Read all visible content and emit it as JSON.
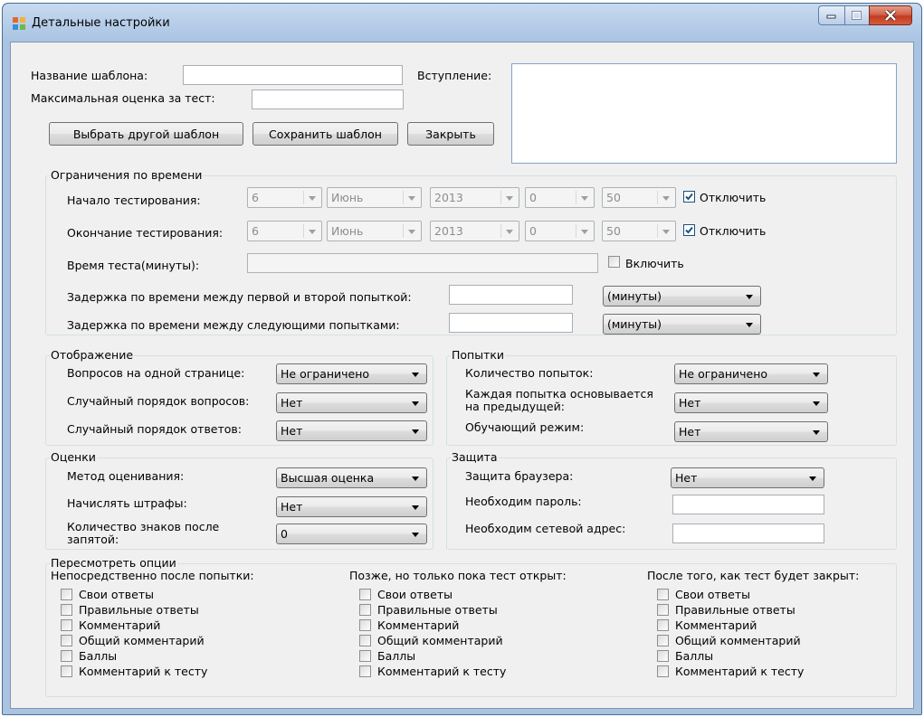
{
  "window": {
    "title": "Детальные настройки"
  },
  "template": {
    "name_label": "Название шаблона:",
    "name_value": "",
    "max_score_label": "Максимальная оценка за тест:",
    "max_score_value": "",
    "intro_label": "Вступление:",
    "intro_value": "",
    "choose_button": "Выбрать другой шаблон",
    "save_button": "Сохранить шаблон",
    "close_button": "Закрыть"
  },
  "time_limits": {
    "title": "Ограничения по времени",
    "start": {
      "label": "Начало тестирования:",
      "day": "6",
      "month": "Июнь",
      "year": "2013",
      "hour": "0",
      "minute": "50",
      "disable_label": "Отключить",
      "disabled": true
    },
    "end": {
      "label": "Окончание тестирования:",
      "day": "6",
      "month": "Июнь",
      "year": "2013",
      "hour": "0",
      "minute": "50",
      "disable_label": "Отключить",
      "disabled": true
    },
    "duration": {
      "label": "Время теста(минуты):",
      "value": "",
      "enable_label": "Включить",
      "enabled": false
    },
    "delay_first": {
      "label": "Задержка по времени между первой и второй попыткой:",
      "value": "",
      "unit": "(минуты)"
    },
    "delay_next": {
      "label": "Задержка по времени между следующими попытками:",
      "value": "",
      "unit": "(минуты)"
    }
  },
  "display": {
    "title": "Отображение",
    "per_page_label": "Вопросов на одной странице:",
    "per_page_value": "Не ограничено",
    "random_questions_label": "Случайный порядок вопросов:",
    "random_questions_value": "Нет",
    "random_answers_label": "Случайный порядок ответов:",
    "random_answers_value": "Нет"
  },
  "attempts": {
    "title": "Попытки",
    "count_label": "Количество попыток:",
    "count_value": "Не ограничено",
    "based_label_1": "Каждая попытка основывается",
    "based_label_2": "на предыдущей:",
    "based_value": "Нет",
    "training_label": "Обучающий режим:",
    "training_value": "Нет"
  },
  "grades": {
    "title": "Оценки",
    "method_label": "Метод оценивания:",
    "method_value": "Высшая оценка",
    "penalties_label": "Начислять штрафы:",
    "penalties_value": "Нет",
    "decimals_label_1": "Количество знаков после",
    "decimals_label_2": "запятой:",
    "decimals_value": "0"
  },
  "security": {
    "title": "Защита",
    "browser_label": "Защита браузера:",
    "browser_value": "Нет",
    "password_label": "Необходим пароль:",
    "password_value": "",
    "network_label": "Необходим сетевой адрес:",
    "network_value": ""
  },
  "review": {
    "title": "Пересмотреть опции",
    "columns": [
      {
        "heading": "Непосредственно после попытки:",
        "options": [
          "Свои ответы",
          "Правильные ответы",
          "Комментарий",
          "Общий комментарий",
          "Баллы",
          "Комментарий к тесту"
        ]
      },
      {
        "heading": "Позже, но только пока тест открыт:",
        "options": [
          "Свои ответы",
          "Правильные ответы",
          "Комментарий",
          "Общий комментарий",
          "Баллы",
          "Комментарий к тесту"
        ]
      },
      {
        "heading": "После того, как тест будет закрыт:",
        "options": [
          "Свои ответы",
          "Правильные ответы",
          "Комментарий",
          "Общий комментарий",
          "Баллы",
          "Комментарий к тесту"
        ]
      }
    ]
  },
  "colors": {
    "window_frame": "#a9c3e0",
    "client_bg": "#f0f0f0",
    "close_button": "#c13a22",
    "checkbox_check": "#1c5180"
  }
}
